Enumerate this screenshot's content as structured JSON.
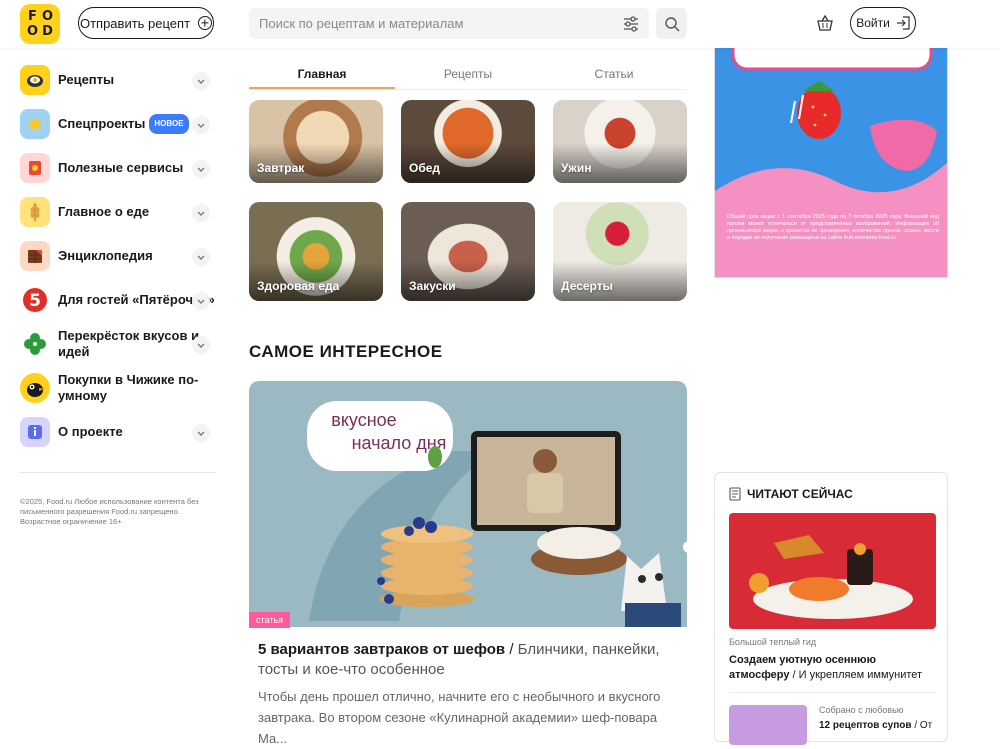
{
  "header": {
    "logo_letters": [
      "F",
      "O",
      "O",
      "D"
    ],
    "submit_label": "Отправить рецепт",
    "search_placeholder": "Поиск по рецептам и материалам",
    "login_label": "Войти"
  },
  "sidebar": {
    "items": [
      {
        "label": "Рецепты",
        "icon": "pan-icon"
      },
      {
        "label": "Спецпроекты",
        "badge": "НОВОЕ",
        "icon": "star-icon"
      },
      {
        "label": "Полезные сервисы",
        "icon": "cookbook-icon"
      },
      {
        "label": "Главное о еде",
        "icon": "wheat-icon"
      },
      {
        "label": "Энциклопедия",
        "icon": "chocolate-icon"
      },
      {
        "label": "Для гостей «Пятёрочки»",
        "icon": "pyaterochka-icon"
      },
      {
        "label": "Перекрёсток вкусов и идей",
        "icon": "clover-icon"
      },
      {
        "label": "Покупки в Чижике по-умному",
        "icon": "chizhik-bird-icon"
      },
      {
        "label": "О проекте",
        "icon": "info-icon"
      }
    ],
    "copyright": "©2025, Food.ru Любое использование контента без письменного разрешения Food.ru запрещено. Возрастное ограничение 16+"
  },
  "tabs": [
    "Главная",
    "Рецепты",
    "Статьи"
  ],
  "categories": [
    {
      "label": "Завтрак",
      "color": "#c9a07a"
    },
    {
      "label": "Обед",
      "color": "#b45a2c"
    },
    {
      "label": "Ужин",
      "color": "#d7cfc6"
    },
    {
      "label": "Здоровая еда",
      "color": "#8a9a5c"
    },
    {
      "label": "Закуски",
      "color": "#7d6a60"
    },
    {
      "label": "Десерты",
      "color": "#e9e4dd"
    }
  ],
  "section_title": "САМОЕ ИНТЕРЕСНОЕ",
  "hero": {
    "banner_line1": "вкусное",
    "banner_line2": "начало дня",
    "tag": "статья",
    "title_bold": "5 вариантов завтраков от шефов",
    "title_sep": " / ",
    "title_sub": "Блинчики, панкейки, тосты и кое-что особенное",
    "desc": "Чтобы день прошел отлично, начните его с необычного и вкусного завтрака. Во втором сезоне «Кулинарной академии» шеф-повара Ма..."
  },
  "ad": {
    "fine_print": "Общий срок акции с 1 сентября 2025 года по 7 октября 2025 года. Внешний вид призов может отличаться от представленных изображений. Информация об организаторе акции, о правилах ее проведения, количестве призов, сроках, месте и порядке их получения размещена на сайте fruit-moments.food.ru"
  },
  "reading_now": {
    "title": "ЧИТАЮТ СЕЙЧАС",
    "item1_kicker": "Большой теплый гид",
    "item1_bold": "Создаем уютную осеннюю атмосферу",
    "item1_sub": " / И укрепляем иммунитет",
    "item2_kicker": "Собрано с любовью",
    "item2_bold": "12 рецептов супов",
    "item2_sub": " / От"
  }
}
